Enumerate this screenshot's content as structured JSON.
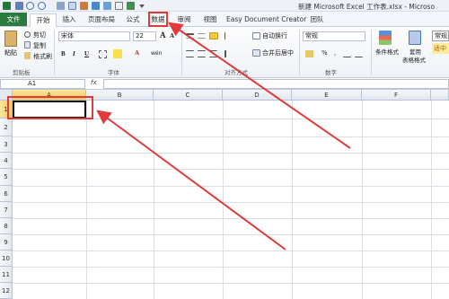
{
  "window": {
    "title": "新建 Microsoft Excel 工作表.xlsx - Microso"
  },
  "quick_access": {
    "icons": [
      "excel-logo-icon",
      "save-icon",
      "undo-icon",
      "redo-icon",
      "print-preview-icon",
      "table-icon",
      "chart-icon",
      "filter-icon",
      "sort-icon",
      "function-icon",
      "image-icon",
      "customize-dropdown-icon"
    ]
  },
  "tabs": {
    "file": "文件",
    "home": "开始",
    "insert": "插入",
    "page_layout": "页面布局",
    "formulas": "公式",
    "data": "数据",
    "review": "审阅",
    "view": "视图",
    "easy_doc": "Easy Document Creator",
    "team": "团队"
  },
  "ribbon": {
    "clipboard": {
      "paste": "粘贴",
      "cut": "剪切",
      "copy": "复制",
      "format_painter": "格式刷",
      "label": "剪贴板"
    },
    "font": {
      "font_name": "宋体",
      "font_size": "22",
      "label": "字体",
      "bold": "B",
      "italic": "I",
      "underline": "U",
      "grow": "A",
      "shrink": "A",
      "font_color": "A",
      "phonetic": "wén"
    },
    "alignment": {
      "wrap_text": "自动换行",
      "merge_center": "合并后居中",
      "label": "对齐方式"
    },
    "number": {
      "format": "常规",
      "label": "数字",
      "percent": "%",
      "comma": ","
    },
    "styles": {
      "conditional_format": "条件格式",
      "format_as_table_line1": "套用",
      "format_as_table_line2": "表格格式",
      "normal": "常规",
      "good": "适中"
    }
  },
  "formula_bar": {
    "name_box": "A1",
    "fx": "fx",
    "value": ""
  },
  "sheet": {
    "columns": [
      "A",
      "B",
      "C",
      "D",
      "E",
      "F"
    ],
    "rows": [
      "1",
      "2",
      "3",
      "4",
      "5",
      "6",
      "7",
      "8",
      "9",
      "10",
      "11",
      "12"
    ],
    "selected_cell": "A1"
  },
  "colors": {
    "file_tab": "#2a7b3e",
    "annotation": "#e03a3a",
    "selection_header": "#f3c55a"
  }
}
